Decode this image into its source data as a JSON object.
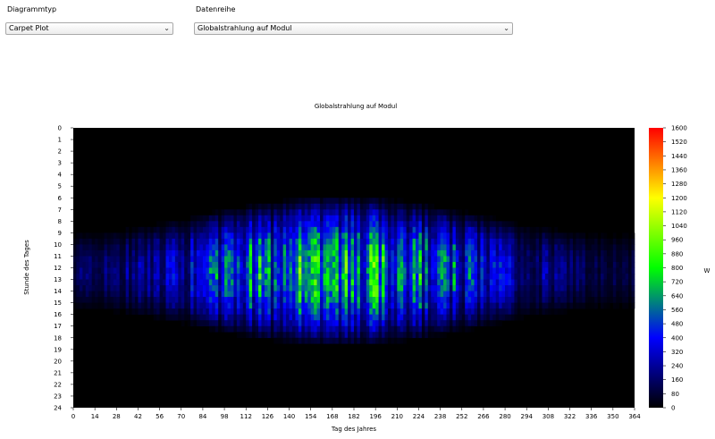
{
  "controls": {
    "chart_type_label": "Diagrammtyp",
    "chart_type_value": "Carpet Plot",
    "series_label": "Datenreihe",
    "series_value": "Globalstrahlung auf Modul"
  },
  "icons": {
    "dropdown": "chevron-down-icon"
  },
  "chart_data": {
    "type": "heatmap",
    "title": "Globalstrahlung auf Modul",
    "xlabel": "Tag des Jahres",
    "ylabel": "Stunde des Tages",
    "colorbar_label": "W",
    "xlim": [
      0,
      364
    ],
    "ylim": [
      0,
      24
    ],
    "x_ticks": [
      0,
      14,
      28,
      42,
      56,
      70,
      84,
      98,
      112,
      126,
      140,
      154,
      168,
      182,
      196,
      210,
      224,
      238,
      252,
      266,
      280,
      294,
      308,
      322,
      336,
      350,
      364
    ],
    "y_ticks": [
      0,
      1,
      2,
      3,
      4,
      5,
      6,
      7,
      8,
      9,
      10,
      11,
      12,
      13,
      14,
      15,
      16,
      17,
      18,
      19,
      20,
      21,
      22,
      23,
      24
    ],
    "color_range": [
      0,
      1600
    ],
    "colorbar_ticks": [
      0,
      80,
      160,
      240,
      320,
      400,
      480,
      560,
      640,
      720,
      800,
      880,
      960,
      1040,
      1120,
      1200,
      1280,
      1360,
      1440,
      1520,
      1600
    ],
    "colormap": [
      "#000000",
      "#0000ff",
      "#00ff00",
      "#ffff00",
      "#ff0000"
    ],
    "background": "#000000",
    "grid": false,
    "legend": "colorbar-right"
  }
}
